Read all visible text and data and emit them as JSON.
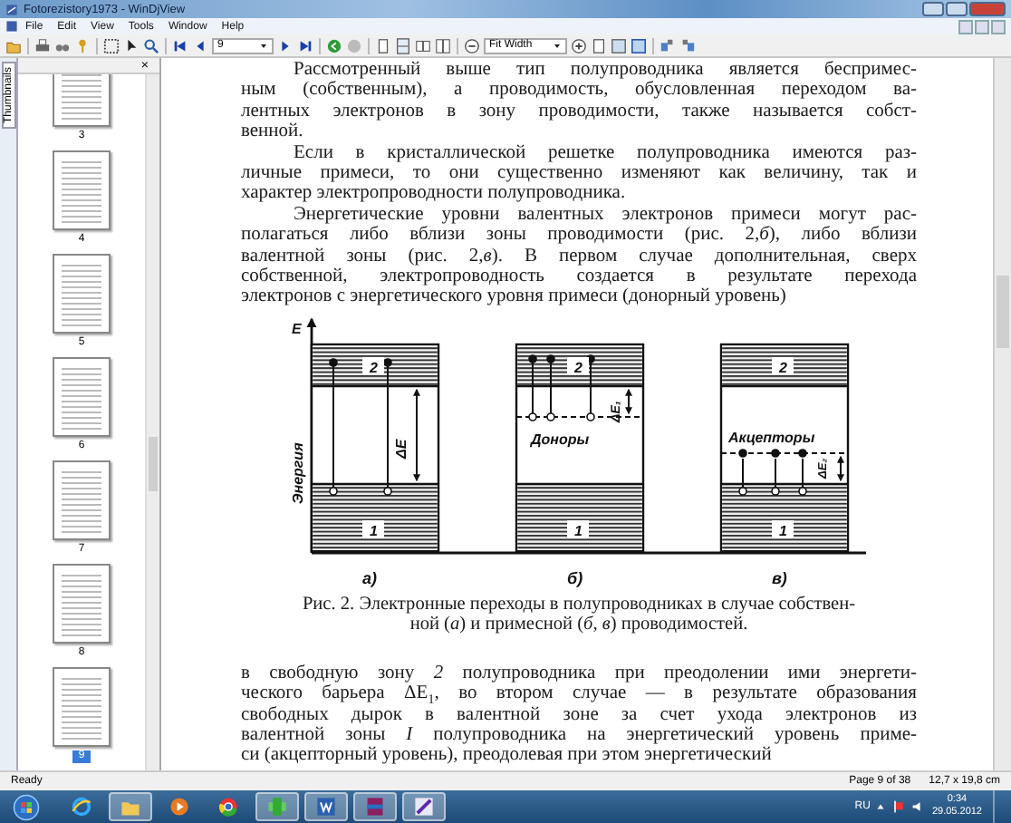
{
  "window": {
    "title": "Fotorezistory1973 - WinDjView",
    "menu": [
      "File",
      "Edit",
      "View",
      "Tools",
      "Window",
      "Help"
    ]
  },
  "toolbar": {
    "page": "9",
    "zoom": "Fit Width"
  },
  "sidebar": {
    "tab": "Thumbnails",
    "close": "×",
    "thumbnails": [
      {
        "label": "3",
        "selected": false
      },
      {
        "label": "4",
        "selected": false
      },
      {
        "label": "5",
        "selected": false
      },
      {
        "label": "6",
        "selected": false
      },
      {
        "label": "7",
        "selected": false
      },
      {
        "label": "8",
        "selected": false
      },
      {
        "label": "9",
        "selected": true
      }
    ]
  },
  "document": {
    "paragraphs_before": [
      {
        "continued": false,
        "lines": [
          "Рассмотренный выше тип полупроводника является беспримес-",
          "ным (собственным), а проводимость, обусловленная переходом ва-",
          "лентных электронов в зону проводимости, также называется собст-",
          "венной."
        ]
      },
      {
        "continued": false,
        "lines": [
          "Если в кристаллической решетке полупроводника имеются раз-",
          "личные примеси, то они существенно изменяют как величину, так и",
          "характер электропроводности полупроводника."
        ]
      },
      {
        "continued": false,
        "lines": [
          "Энергетические уровни валентных электронов примеси могут рас-",
          "полагаться либо вблизи зоны проводимости (рис. 2,*б*), либо вблизи",
          "валентной зоны (рис. 2,*в*). В первом случае дополнительная, сверх",
          "собственной, электропроводность создается в результате перехода",
          "электронов с энергетического уровня примеси (донорный уровень)"
        ]
      }
    ],
    "figure": {
      "axis_label": "E",
      "y_label": "Энергия",
      "donors": "Доноры",
      "acceptors": "Акцепторы",
      "gap": "ΔE",
      "gap_donor": "ΔE₁",
      "gap_acceptor": "ΔE₂",
      "panels": [
        {
          "label": "а)",
          "upper": "2",
          "lower": "1"
        },
        {
          "label": "б)",
          "upper": "2",
          "lower": "1"
        },
        {
          "label": "в)",
          "upper": "2",
          "lower": "1"
        }
      ]
    },
    "caption": [
      "Рис. 2. Электронные переходы в полупроводниках в случае собствен-",
      "ной (*а*) и примесной (*б*, *в*) проводимостей."
    ],
    "paragraphs_after": [
      {
        "continued": true,
        "lines": [
          "в свободную зону *2* полупроводника при преодолении ими энергети-",
          "ческого барьера ΔE$_{1}$, во втором случае — в результате образования",
          "свободных дырок в валентной зоне за счет ухода электронов из",
          "валентной зоны *I* полупроводника на энергетический уровень приме-",
          "си (акцепторный уровень), преодолевая при этом энергетический"
        ]
      }
    ]
  },
  "status_bar": {
    "state": "Ready",
    "page": "Page 9 of 38",
    "size": "12,7 x 19,8 cm"
  },
  "taskbar": {
    "language": "RU",
    "time": "0:34",
    "date": "29.05.2012"
  }
}
